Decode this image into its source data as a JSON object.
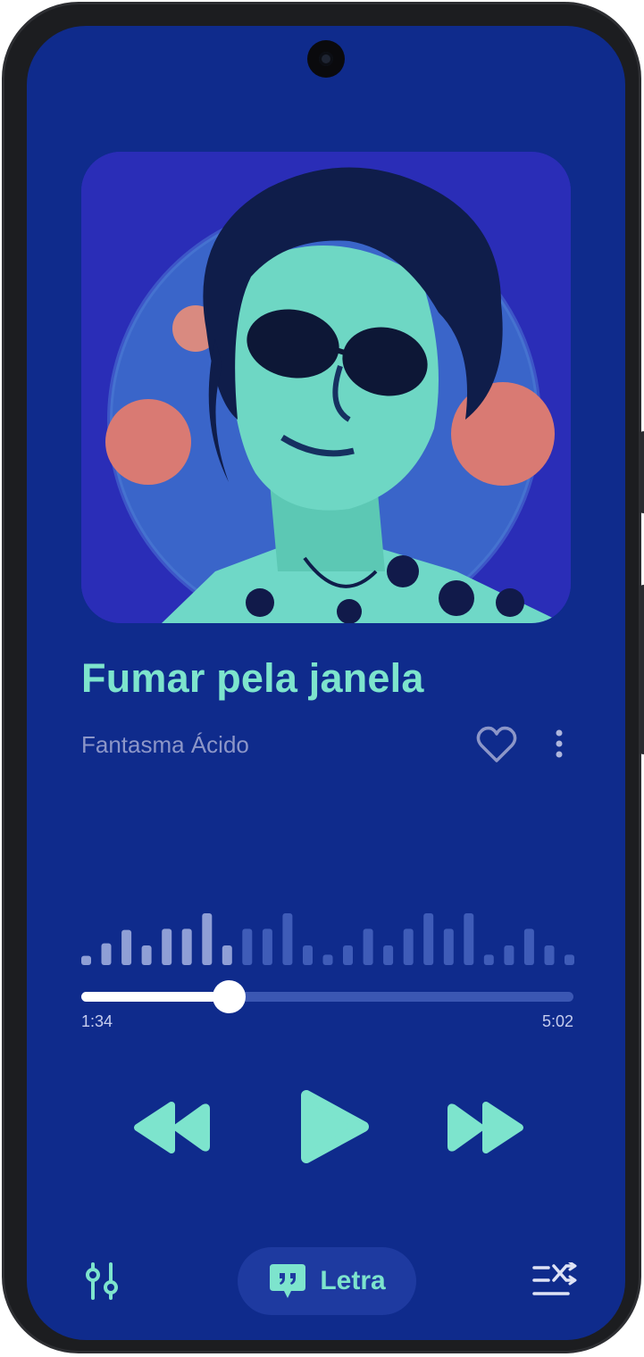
{
  "song": {
    "title": "Fumar pela janela",
    "artist": "Fantasma Ácido"
  },
  "playback": {
    "current_time": "1:34",
    "total_time": "5:02",
    "progress": 0.3
  },
  "waveform_levels": [
    0.18,
    0.42,
    0.68,
    0.38,
    0.7,
    0.7,
    1.0,
    0.38,
    0.7,
    0.7,
    1.0,
    0.38,
    0.2,
    0.38,
    0.7,
    0.38,
    0.7,
    1.0,
    0.7,
    1.0,
    0.2,
    0.38,
    0.7,
    0.38,
    0.2
  ],
  "controls": {
    "rewind_icon": "rewind-icon",
    "play_icon": "play-icon",
    "fast_forward_icon": "fast-forward-icon"
  },
  "bottom_bar": {
    "equalizer_icon": "equalizer-icon",
    "lyrics_label": "Letra",
    "lyrics_icon": "quote-bubble-icon",
    "queue_icon": "queue-shuffle-icon"
  },
  "colors": {
    "background": "#0f2b8c",
    "accent": "#7de4cd",
    "muted_text": "#8c96c8",
    "lyrics_pill": "#1e3aa0"
  }
}
